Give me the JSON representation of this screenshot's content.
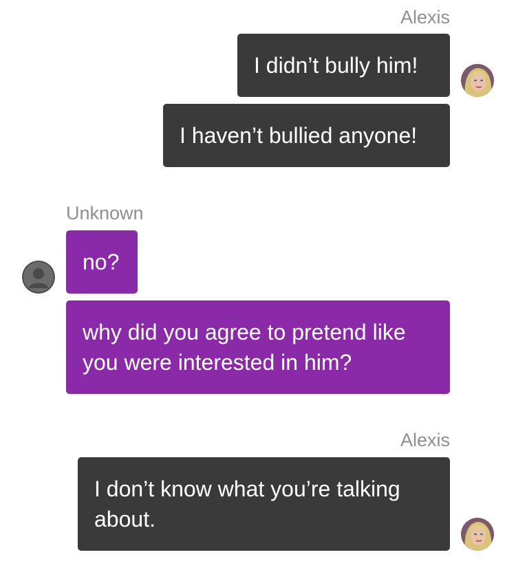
{
  "colors": {
    "outgoing_bubble": "#3a3a3a",
    "incoming_bubble": "#8a2aa9",
    "sender_name": "#8e8e93",
    "bubble_text": "#ffffff"
  },
  "messages": [
    {
      "sender": "Alexis",
      "side": "right",
      "avatar": "alexis-avatar",
      "bubbles": [
        "I didn’t bully him!",
        "I haven’t bullied anyone!"
      ]
    },
    {
      "sender": "Unknown",
      "side": "left",
      "avatar": "unknown-user-avatar",
      "bubbles": [
        "no?",
        "why did you agree to pretend like you were interested in him?"
      ]
    },
    {
      "sender": "Alexis",
      "side": "right",
      "avatar": "alexis-avatar",
      "bubbles": [
        "I don’t know what you’re talking about."
      ]
    }
  ]
}
